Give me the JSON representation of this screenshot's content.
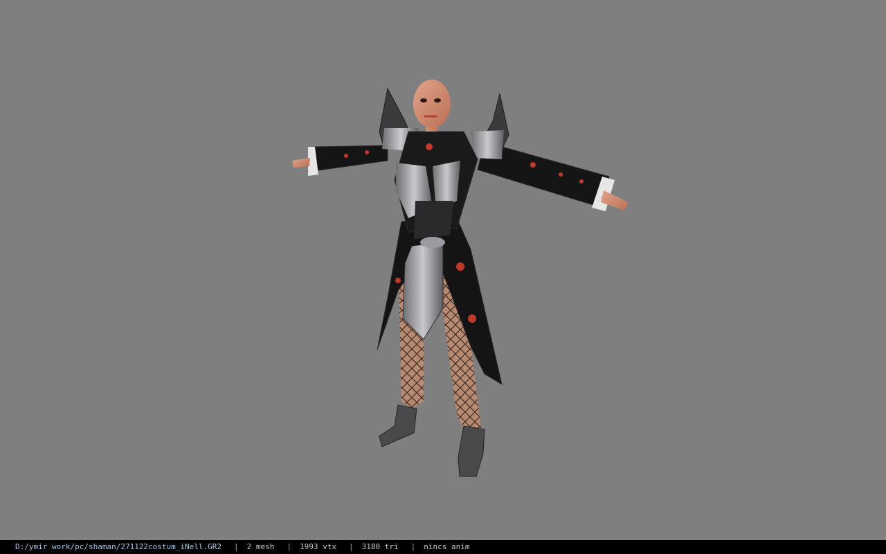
{
  "viewport": {
    "background": "#7f7f7f",
    "model_description_icon": "character-model-icon"
  },
  "status_bar": {
    "file_path": "D:/ymir work/pc/shaman/271122costum_iNell.GR2",
    "separator": "|",
    "mesh": "2 mesh",
    "vtx": "1993 vtx",
    "tri": "3180 tri",
    "anim": "nincs anim"
  },
  "colors": {
    "status_bg": "#000000",
    "path_text": "#a6c8e6",
    "info_text": "#c8c8c8"
  }
}
